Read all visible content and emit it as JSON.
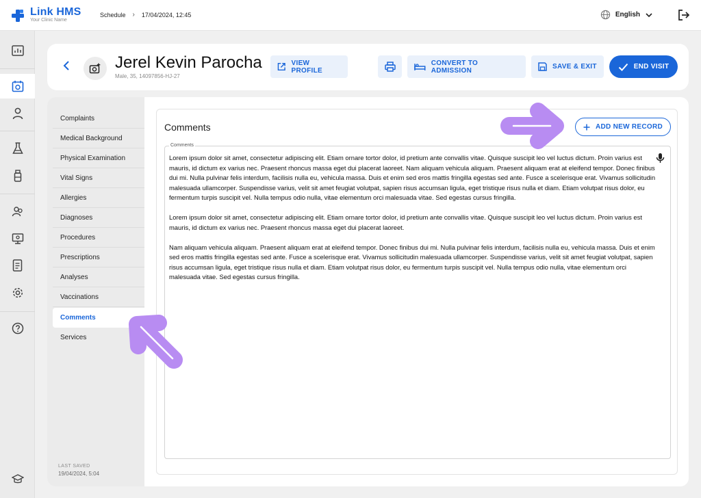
{
  "app": {
    "name": "Link HMS",
    "subtitle": "Your Clinic Name",
    "breadcrumb": [
      "Schedule",
      "17/04/2024, 12:45"
    ],
    "language": "English"
  },
  "rail_icons": [
    "dashboard-icon",
    "calendar-icon",
    "user-icon",
    "flask-icon",
    "vial-icon",
    "users-icon",
    "monitor-icon",
    "document-icon",
    "gear-icon",
    "help-icon",
    "graduation-icon"
  ],
  "patient": {
    "name": "Jerel Kevin Parocha",
    "meta": "Male, 35, 14097856-HJ-27"
  },
  "actions": {
    "view_profile": "VIEW PROFILE",
    "convert": "CONVERT TO ADMISSION",
    "save_exit": "SAVE & EXIT",
    "end_visit": "END VISIT"
  },
  "nav": {
    "items": [
      "Complaints",
      "Medical Background",
      "Physical Examination",
      "Vital Signs",
      "Allergies",
      "Diagnoses",
      "Procedures",
      "Prescriptions",
      "Analyses",
      "Vaccinations",
      "Comments",
      "Services"
    ],
    "active": "Comments",
    "last_saved_label": "LAST SAVED",
    "last_saved_value": "19/04/2024, 5:04"
  },
  "comments": {
    "title": "Comments",
    "add_label": "ADD NEW RECORD",
    "field_label": "Comments",
    "paragraphs": [
      "Lorem ipsum dolor sit amet, consectetur adipiscing elit. Etiam ornare tortor dolor, id pretium ante convallis vitae. Quisque suscipit leo vel luctus dictum. Proin varius est mauris, id dictum ex varius nec. Praesent rhoncus massa eget dui placerat laoreet. Nam aliquam vehicula aliquam. Praesent aliquam erat at eleifend tempor. Donec finibus dui mi. Nulla pulvinar felis interdum, facilisis nulla eu, vehicula massa. Duis et enim sed eros mattis fringilla egestas sed ante. Fusce a scelerisque erat. Vivamus sollicitudin malesuada ullamcorper. Suspendisse varius, velit sit amet feugiat volutpat, sapien risus accumsan ligula, eget tristique risus nulla et diam. Etiam volutpat risus dolor, eu fermentum turpis suscipit vel. Nulla tempus odio nulla, vitae elementum orci malesuada vitae. Sed egestas cursus fringilla.",
      "Lorem ipsum dolor sit amet, consectetur adipiscing elit. Etiam ornare tortor dolor, id pretium ante convallis vitae. Quisque suscipit leo vel luctus dictum. Proin varius est mauris, id dictum ex varius nec. Praesent rhoncus massa eget dui placerat laoreet.",
      "Nam aliquam vehicula aliquam. Praesent aliquam erat at eleifend tempor. Donec finibus dui mi. Nulla pulvinar felis interdum, facilisis nulla eu, vehicula massa. Duis et enim sed eros mattis fringilla egestas sed ante. Fusce a scelerisque erat. Vivamus sollicitudin malesuada ullamcorper. Suspendisse varius, velit sit amet feugiat volutpat, sapien risus accumsan ligula, eget tristique risus nulla et diam. Etiam volutpat risus dolor, eu fermentum turpis suscipit vel. Nulla tempus odio nulla, vitae elementum orci malesuada vitae. Sed egestas cursus fringilla."
    ]
  },
  "colors": {
    "accent": "#1a66d9",
    "annotation": "#b88cf2"
  }
}
